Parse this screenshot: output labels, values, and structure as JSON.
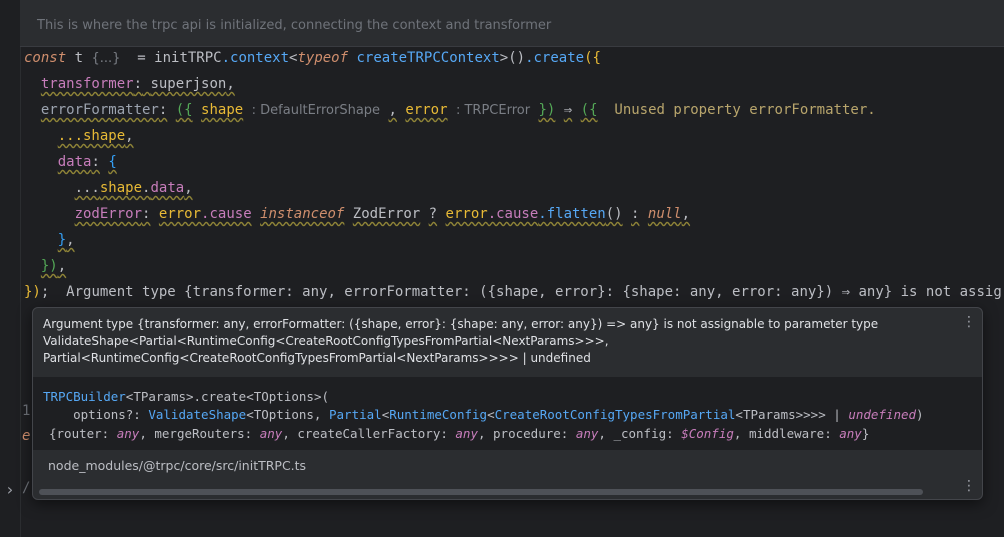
{
  "doc_comment": "This is where the trpc api is initialized, connecting the context and transformer",
  "code": {
    "line1": {
      "kw_const": "const",
      "var_t": "t",
      "hint_destructure": "{...}",
      "eq": "=",
      "fn_init": "initTRPC",
      "dot_context": ".context",
      "lt": "<",
      "kw_typeof": "typeof",
      "fn_create_ctx": "createTRPCContext",
      "gt": ">",
      "paren": "()",
      "dot_create": ".create",
      "open": "({"
    },
    "line2": {
      "prop": "transformer",
      "colon": ":",
      "value": "superjson",
      "comma": ","
    },
    "line3": {
      "prop": "errorFormatter",
      "colon": ":",
      "open": "({",
      "param_shape": "shape",
      "hint_shape_type": ": DefaultErrorShape",
      "comma": ",",
      "param_error": "error",
      "hint_error_type": ": TRPCError",
      "close": "})",
      "arrow": "⇒",
      "open2": "({",
      "warning": "Unused property errorFormatter."
    },
    "line4": {
      "spread": "...shape",
      "comma": ","
    },
    "line5": {
      "prop": "data",
      "colon": ":",
      "open": "{"
    },
    "line6": {
      "spread_dots": "...",
      "obj": "shape",
      "dot": ".",
      "prop": "data",
      "comma": ","
    },
    "line7": {
      "prop": "zodError",
      "colon": ":",
      "err1": "error",
      "cause1": ".cause",
      "kw_instanceof": "instanceof",
      "cls": "ZodError",
      "q": "?",
      "err2": "error",
      "cause2": ".cause",
      "flatten": ".flatten",
      "call": "()",
      "colon2": ":",
      "null": "null",
      "comma": ","
    },
    "line8": {
      "close": "}",
      "comma": ","
    },
    "line9": {
      "close": "})",
      "comma": ","
    },
    "line10": {
      "close": "})",
      "semi": ";",
      "error_msg": "Argument type {transformer: any, errorFormatter: ({shape, error}: {shape: any, error: any}) ⇒ any} is not assig"
    }
  },
  "tooltip": {
    "message_l1": "Argument type {transformer: any, errorFormatter: ({shape, error}: {shape: any, error: any}) => any} is not assignable to parameter type",
    "message_l2": "ValidateShape<Partial<RuntimeConfig<CreateRootConfigTypesFromPartial<NextParams>>>,",
    "message_l3": "Partial<RuntimeConfig<CreateRootConfigTypesFromPartial<NextParams>>>> | undefined",
    "sig": {
      "l1_cls": "TRPCBuilder",
      "l1_tparams": "<TParams>.create<TOptions>(",
      "l2_indent": "    options?: ",
      "l2_validate": "ValidateShape",
      "l2_a": "<TOptions, ",
      "l2_partial": "Partial",
      "l2_b": "<",
      "l2_runtime": "RuntimeConfig",
      "l2_c": "<",
      "l2_create": "CreateRootConfigTypesFromPartial",
      "l2_d": "<TParams>>>> | ",
      "l2_undef": "undefined",
      "l2_e": ")",
      "l3_a": "{router: ",
      "l3_any1": "any",
      "l3_b": ", mergeRouters: ",
      "l3_any2": "any",
      "l3_c": ", createCallerFactory: ",
      "l3_any3": "any",
      "l3_d": ", procedure: ",
      "l3_any4": "any",
      "l3_e": ", _config: ",
      "l3_config": "$Config",
      "l3_f": ", middleware: ",
      "l3_any5": "any",
      "l3_g": "}"
    },
    "path": "node_modules/@trpc/core/src/initTRPC.ts",
    "menu_glyph": "⋮"
  },
  "gutter": {
    "chevron": "›",
    "line_num": "1",
    "frag_e": "e",
    "frag_slash": "/"
  }
}
